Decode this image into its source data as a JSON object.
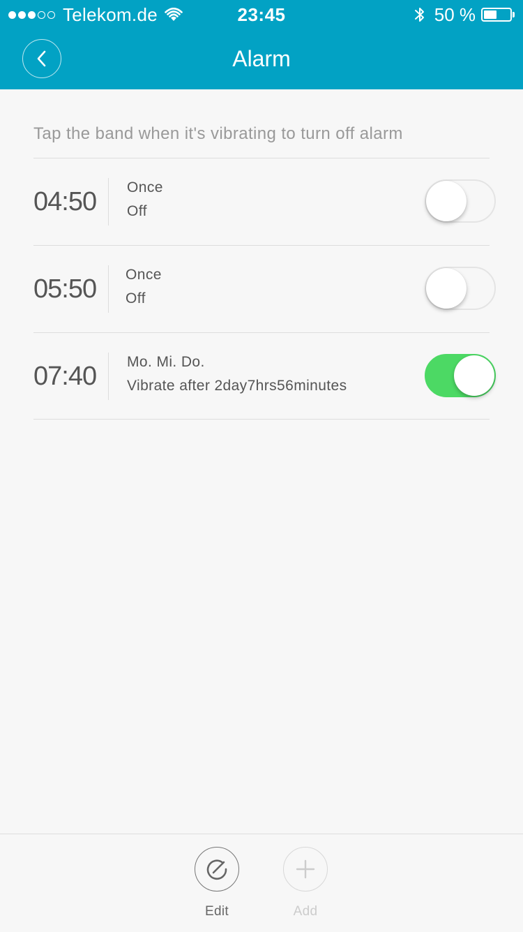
{
  "status_bar": {
    "carrier": "Telekom.de",
    "time": "23:45",
    "battery_text": "50 %",
    "battery_level": 0.5,
    "signal_bars_filled": 3,
    "signal_bars_total": 5
  },
  "header": {
    "title": "Alarm",
    "background_color": "#02a2c4"
  },
  "hint": "Tap the band when it's vibrating to turn off alarm",
  "alarms": [
    {
      "time": "04:50",
      "repeat": "Once",
      "status": "Off",
      "enabled": false
    },
    {
      "time": "05:50",
      "repeat": "Once",
      "status": "Off",
      "enabled": false
    },
    {
      "time": "07:40",
      "repeat": "Mo. Mi. Do.",
      "status": "Vibrate after 2day7hrs56minutes",
      "enabled": true
    }
  ],
  "toolbar": {
    "edit_label": "Edit",
    "add_label": "Add"
  },
  "colors": {
    "accent": "#02a2c4",
    "toggle_on": "#4cd964"
  },
  "icons": {
    "back": "chevron-left-icon",
    "edit": "edit-icon",
    "add": "plus-icon",
    "wifi": "wifi-icon",
    "bluetooth": "bluetooth-icon",
    "battery": "battery-icon"
  }
}
